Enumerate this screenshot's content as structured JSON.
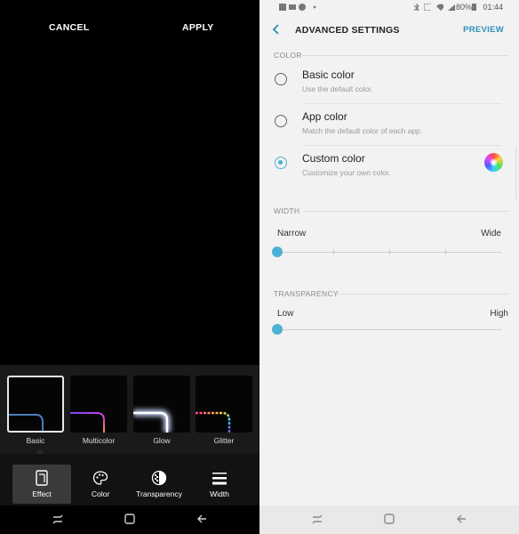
{
  "left_panel": {
    "cancel_label": "CANCEL",
    "apply_label": "APPLY",
    "effects": [
      {
        "label": "Basic",
        "selected": true
      },
      {
        "label": "Multicolor",
        "selected": false
      },
      {
        "label": "Glow",
        "selected": false
      },
      {
        "label": "Glitter",
        "selected": false
      }
    ],
    "toolbar": [
      {
        "label": "Effect",
        "icon": "effect-icon",
        "active": true
      },
      {
        "label": "Color",
        "icon": "palette-icon",
        "active": false
      },
      {
        "label": "Transparency",
        "icon": "transparency-icon",
        "active": false
      },
      {
        "label": "Width",
        "icon": "width-icon",
        "active": false
      }
    ]
  },
  "right_panel": {
    "status": {
      "battery": "80%",
      "time": "01:44"
    },
    "header": {
      "title": "ADVANCED SETTINGS",
      "preview_label": "PREVIEW"
    },
    "color_section": {
      "heading": "COLOR",
      "options": [
        {
          "title": "Basic color",
          "subtitle": "Use the default color.",
          "selected": false
        },
        {
          "title": "App color",
          "subtitle": "Match the default color of each app.",
          "selected": false
        },
        {
          "title": "Custom color",
          "subtitle": "Customize your own color.",
          "selected": true
        }
      ]
    },
    "width_section": {
      "heading": "WIDTH",
      "min_label": "Narrow",
      "max_label": "Wide",
      "value": 0
    },
    "transparency_section": {
      "heading": "TRANSPARENCY",
      "min_label": "Low",
      "max_label": "High",
      "value": 0
    }
  },
  "colors": {
    "accent": "#4db0d4",
    "preview_text": "#2e90b4",
    "left_bg": "#000000",
    "right_bg": "#f2f2f2"
  }
}
